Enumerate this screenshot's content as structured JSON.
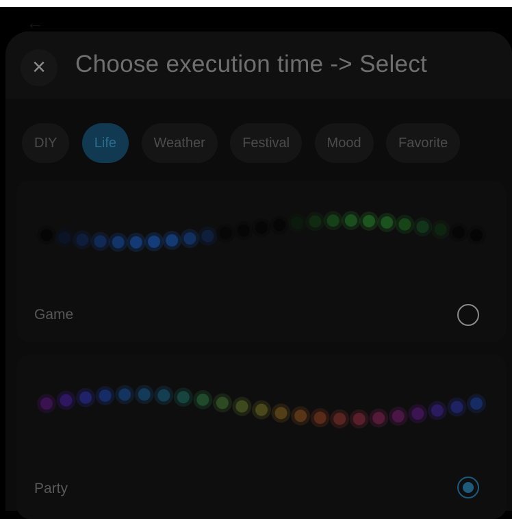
{
  "header": {
    "back_icon": "arrow-left-icon",
    "close_icon": "close-icon",
    "title": "Choose execution time -> Select"
  },
  "tabs": [
    {
      "label": "DIY",
      "active": false
    },
    {
      "label": "Life",
      "active": true
    },
    {
      "label": "Weather",
      "active": false
    },
    {
      "label": "Festival",
      "active": false
    },
    {
      "label": "Mood",
      "active": false
    },
    {
      "label": "Favorite",
      "active": false
    }
  ],
  "scenes": [
    {
      "name": "Game",
      "selected": false,
      "light_colors": [
        "#050505",
        "#0a1426",
        "#0d1d3a",
        "#102a55",
        "#123468",
        "#133a74",
        "#143c78",
        "#143a74",
        "#12305f",
        "#0e1f3c",
        "#070707",
        "#060606",
        "#060606",
        "#060606",
        "#0b1a0c",
        "#102a12",
        "#164018",
        "#1a4e1c",
        "#1c561e",
        "#1b521d",
        "#174518",
        "#11341a",
        "#0d2410",
        "#060606",
        "#050505"
      ]
    },
    {
      "name": "Party",
      "selected": true,
      "light_colors": [
        "#3a1250",
        "#2e1660",
        "#1f2268",
        "#162c66",
        "#14345f",
        "#143a5a",
        "#143f52",
        "#16453f",
        "#1f4a2c",
        "#2e4a22",
        "#3e4a1e",
        "#4a471a",
        "#523f17",
        "#573516",
        "#582b18",
        "#582420",
        "#581e2a",
        "#541a38",
        "#4a1646",
        "#3c1452",
        "#2c1a5e",
        "#1e2262",
        "#162a64"
      ]
    }
  ],
  "colors": {
    "accent": "#113a52",
    "background": "#000000"
  }
}
